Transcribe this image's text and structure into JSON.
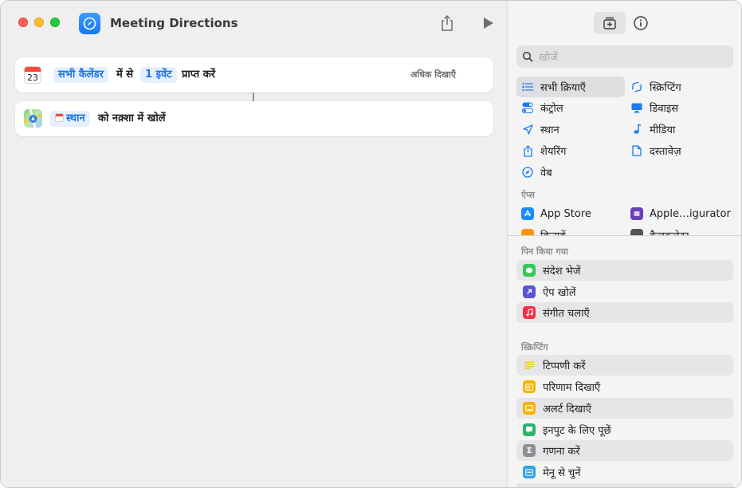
{
  "window": {
    "title": "Meeting Directions"
  },
  "editor": {
    "action1": {
      "cal_day": "23",
      "token_calendars": "सभी कैलेंडर",
      "text_from": "में से",
      "token_count": "1 इवेंट",
      "text_get": "प्राप्त करें",
      "show_more": "अधिक दिखाएँ"
    },
    "action2": {
      "token_location": "स्थान",
      "text_open": "को नक़्शा में खोलें"
    }
  },
  "sidebar": {
    "search_placeholder": "खोजें",
    "categories_left": [
      {
        "label": "सभी क्रियाएँ",
        "icon": "list-icon"
      },
      {
        "label": "कंट्रोल",
        "icon": "toggle-icon"
      },
      {
        "label": "स्थान",
        "icon": "location-arrow-icon"
      },
      {
        "label": "शेयरिंग",
        "icon": "share-icon"
      },
      {
        "label": "वेब",
        "icon": "compass-icon"
      }
    ],
    "categories_right": [
      {
        "label": "स्क्रिप्टिंग",
        "icon": "scripting-icon"
      },
      {
        "label": "डिवाइस",
        "icon": "monitor-icon"
      },
      {
        "label": "मीडिया",
        "icon": "music-note-icon"
      },
      {
        "label": "दस्तावेज़",
        "icon": "document-icon"
      }
    ],
    "apps_label": "ऐप्स",
    "apps": [
      {
        "label": "App Store",
        "icon": "app-store-icon",
        "color": "#1a8cff"
      },
      {
        "label": "Apple…igurator",
        "icon": "apple-configurator-icon",
        "color": "#6b3fb8"
      },
      {
        "label": "किताबें",
        "icon": "books-icon",
        "color": "#ff9500"
      },
      {
        "label": "कैलकुलेटर",
        "icon": "calculator-icon",
        "color": "#555555"
      }
    ],
    "pinned_label": "पिन किया गया",
    "pinned": [
      {
        "label": "संदेश भेजें",
        "icon": "messages-icon",
        "color": "#34c759"
      },
      {
        "label": "ऐप खोलें",
        "icon": "open-app-icon",
        "color": "#5856d6"
      },
      {
        "label": "संगीत चलाएँ",
        "icon": "music-icon",
        "color": "#fa2d48"
      }
    ],
    "scripting_label": "स्क्रिप्टिंग",
    "scripting": [
      {
        "label": "टिप्पणी करें",
        "icon": "comment-lines-icon",
        "color": "#f5c518"
      },
      {
        "label": "परिणाम दिखाएँ",
        "icon": "show-result-icon",
        "color": "#f5b400"
      },
      {
        "label": "अलर्ट दिखाएँ",
        "icon": "alert-icon",
        "color": "#f5b400"
      },
      {
        "label": "इनपुट के लिए पूछें",
        "icon": "ask-input-icon",
        "color": "#2fb36d"
      },
      {
        "label": "गणना करें",
        "icon": "sigma-icon",
        "color": "#8e8e93"
      },
      {
        "label": "मेनू से चुनें",
        "icon": "menu-icon",
        "color": "#32a3e6"
      }
    ]
  }
}
